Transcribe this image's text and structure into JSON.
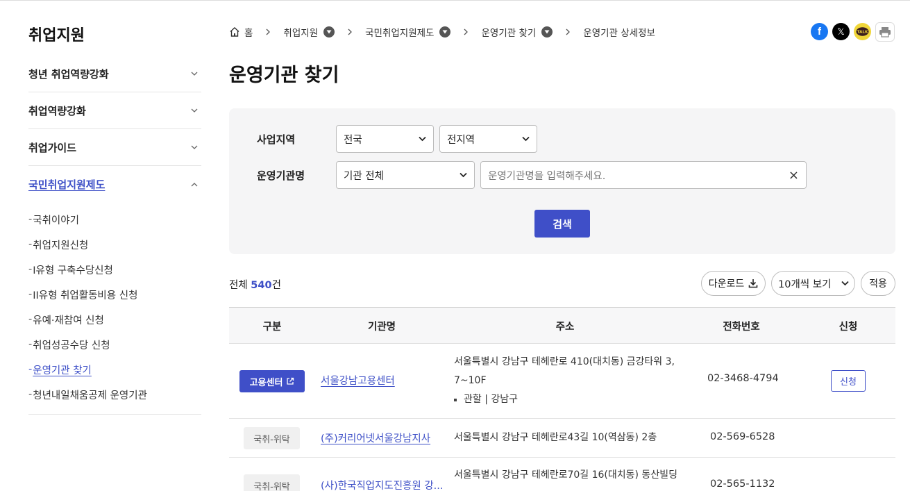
{
  "sidebar": {
    "title": "취업지원",
    "items": [
      {
        "label": "청년 취업역량강화"
      },
      {
        "label": "취업역량강화"
      },
      {
        "label": "취업가이드"
      },
      {
        "label": "국민취업지원제도"
      }
    ],
    "sub_items": [
      {
        "label": "국취이야기"
      },
      {
        "label": "취업지원신청"
      },
      {
        "label": "I유형 구축수당신청"
      },
      {
        "label": "II유형 취업활동비용 신청"
      },
      {
        "label": "유예·재참여 신청"
      },
      {
        "label": "취업성공수당 신청"
      },
      {
        "label": "운영기관 찾기"
      },
      {
        "label": "청년내일채움공제 운영기관"
      }
    ],
    "dash": "-"
  },
  "breadcrumb": {
    "home": "홈",
    "items": [
      "취업지원",
      "국민취업지원제도",
      "운영기관 찾기",
      "운영기관 상세정보"
    ]
  },
  "share": {
    "facebook": "f",
    "x": "𝕏",
    "kakao": "TALK"
  },
  "page_title": "운영기관 찾기",
  "search": {
    "region_label": "사업지역",
    "region_value": "전국",
    "subregion_value": "전지역",
    "org_label": "운영기관명",
    "org_type_value": "기관 전체",
    "org_placeholder": "운영기관명을 입력해주세요.",
    "clear": "×",
    "button": "검색"
  },
  "results": {
    "total_prefix": "전체 ",
    "total_count": "540",
    "total_suffix": "건",
    "download": "다운로드",
    "page_size": "10개씩 보기",
    "apply": "적용"
  },
  "table": {
    "headers": [
      "구분",
      "기관명",
      "주소",
      "전화번호",
      "신청"
    ],
    "rows": [
      {
        "type": "고용센터",
        "name": "서울강남고용센터",
        "address_line1": "서울특별시 강남구 테헤란로 410(대치동) 금강타워 3,",
        "address_line2": "7~10F",
        "jurisdiction": "관할 | 강남구",
        "phone": "02-3468-4794",
        "apply": "신청"
      },
      {
        "type": "국취-위탁",
        "name": "(주)커리어넷서울강남지사",
        "address_line1": "서울특별시 강남구 테헤란로43길 10(역삼동) 2층",
        "phone": "02-569-6528"
      },
      {
        "type": "국취-위탁",
        "name": "(사)한국직업지도진흥원 강...",
        "address_line1": "서울특별시 강남구 테헤란로70길 16(대치동) 동산빌딩",
        "phone": "02-565-1132"
      }
    ]
  },
  "colors": {
    "accent": "#3f4fc8",
    "link": "#3d4fc7",
    "panel_bg": "#f5f5f6"
  },
  "icons": [
    "home-icon",
    "chevron-right-icon",
    "dropdown-circle-icon",
    "facebook-icon",
    "x-icon",
    "kakaotalk-icon",
    "print-icon",
    "chevron-down-icon",
    "chevron-up-icon",
    "close-icon",
    "download-icon",
    "external-link-icon"
  ]
}
